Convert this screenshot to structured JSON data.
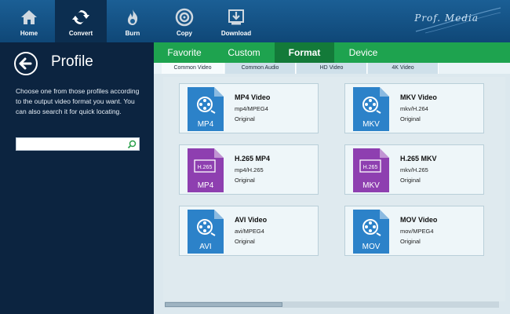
{
  "toolbar": {
    "items": [
      {
        "label": "Home",
        "icon": "home-icon"
      },
      {
        "label": "Convert",
        "icon": "convert-icon",
        "active": true
      },
      {
        "label": "Burn",
        "icon": "burn-icon"
      },
      {
        "label": "Copy",
        "icon": "copy-icon"
      },
      {
        "label": "Download",
        "icon": "download-icon"
      }
    ],
    "brand": "Prof. Media"
  },
  "left_panel": {
    "title": "Profile",
    "description": "Choose one from those profiles according to the output video format you want. You can also search it for quick locating.",
    "search": {
      "value": "",
      "placeholder": ""
    }
  },
  "tabs": [
    {
      "label": "Favorite"
    },
    {
      "label": "Custom"
    },
    {
      "label": "Format",
      "active": true
    },
    {
      "label": "Device"
    }
  ],
  "subtabs": [
    {
      "label": "Common Video",
      "active": true
    },
    {
      "label": "Common Audio"
    },
    {
      "label": "HD Video"
    },
    {
      "label": "4K Video"
    }
  ],
  "profiles": [
    {
      "name": "MP4 Video",
      "codec": "mp4/MPEG4",
      "quality": "Original",
      "badge": "MP4",
      "badge_top": "",
      "color": "#2c82c9",
      "kind": "film"
    },
    {
      "name": "MKV Video",
      "codec": "mkv/H.264",
      "quality": "Original",
      "badge": "MKV",
      "badge_top": "",
      "color": "#2c82c9",
      "kind": "film"
    },
    {
      "name": "H.265 MP4",
      "codec": "mp4/H.265",
      "quality": "Original",
      "badge": "MP4",
      "badge_top": "H.265",
      "color": "#8e3fb0",
      "kind": "h265"
    },
    {
      "name": "H.265 MKV",
      "codec": "mkv/H.265",
      "quality": "Original",
      "badge": "MKV",
      "badge_top": "H.265",
      "color": "#8e3fb0",
      "kind": "h265"
    },
    {
      "name": "AVI Video",
      "codec": "avi/MPEG4",
      "quality": "Original",
      "badge": "AVI",
      "badge_top": "",
      "color": "#2c82c9",
      "kind": "film"
    },
    {
      "name": "MOV Video",
      "codec": "mov/MPEG4",
      "quality": "Original",
      "badge": "MOV",
      "badge_top": "",
      "color": "#2c82c9",
      "kind": "film"
    }
  ],
  "colors": {
    "toolbar": "#1b5f95",
    "tab_bar": "#1ea34f",
    "tab_active": "#137a39",
    "sidebar": "#0c2440"
  }
}
